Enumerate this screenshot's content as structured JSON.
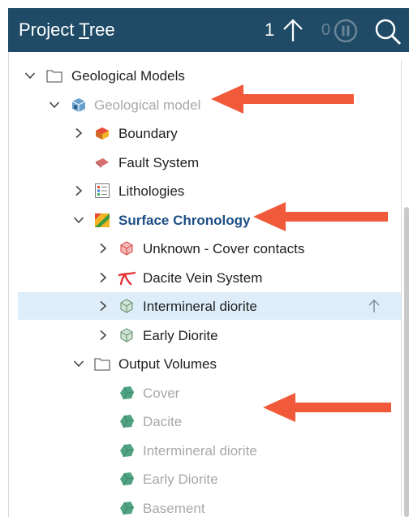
{
  "header": {
    "title_prefix": "Project ",
    "title_underlined": "T",
    "title_suffix": "ree",
    "count_up": "1",
    "count_dim": "0"
  },
  "tree": [
    {
      "label": "Geological Models",
      "icon": "folder-icon",
      "chevron": "down"
    },
    {
      "label": "Geological model",
      "icon": "geological-model-icon",
      "chevron": "down",
      "style": "muted"
    },
    {
      "label": "Boundary",
      "icon": "boundary-icon",
      "chevron": "right"
    },
    {
      "label": "Fault System",
      "icon": "fault-system-icon",
      "chevron": "none"
    },
    {
      "label": "Lithologies",
      "icon": "lithologies-icon",
      "chevron": "right"
    },
    {
      "label": "Surface Chronology",
      "icon": "surface-chronology-icon",
      "chevron": "down",
      "style": "bold"
    },
    {
      "label": "Unknown - Cover contacts",
      "icon": "contact-surface-icon",
      "chevron": "right"
    },
    {
      "label": "Dacite Vein System",
      "icon": "vein-system-icon",
      "chevron": "right"
    },
    {
      "label": "Intermineral diorite",
      "icon": "intrusion-icon",
      "chevron": "right",
      "selected": true
    },
    {
      "label": "Early Diorite",
      "icon": "intrusion-icon",
      "chevron": "right"
    },
    {
      "label": "Output Volumes",
      "icon": "folder-icon",
      "chevron": "down"
    },
    {
      "label": "Cover",
      "icon": "output-volume-icon",
      "chevron": "none",
      "style": "muted"
    },
    {
      "label": "Dacite",
      "icon": "output-volume-icon",
      "chevron": "none",
      "style": "muted"
    },
    {
      "label": "Intermineral diorite",
      "icon": "output-volume-icon",
      "chevron": "none",
      "style": "muted"
    },
    {
      "label": "Early Diorite",
      "icon": "output-volume-icon",
      "chevron": "none",
      "style": "muted"
    },
    {
      "label": "Basement",
      "icon": "output-volume-icon",
      "chevron": "none",
      "style": "muted"
    }
  ],
  "colors": {
    "header_bg": "#1f4b66",
    "selected_row": "#ddeefa",
    "annotation_arrow": "#f05a3a",
    "output_volume": "#4fa382"
  }
}
